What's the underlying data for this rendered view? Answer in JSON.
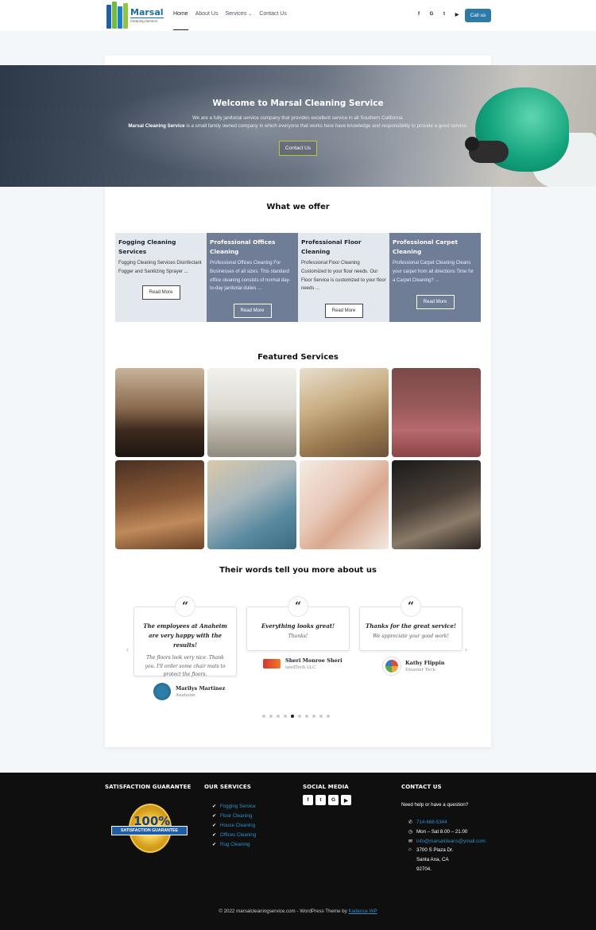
{
  "header": {
    "logo": {
      "name": "Marsal",
      "tagline": "Cleaning Service"
    },
    "nav": [
      {
        "label": "Home",
        "active": true
      },
      {
        "label": "About Us"
      },
      {
        "label": "Services",
        "has_dropdown": true
      },
      {
        "label": "Contact Us"
      }
    ],
    "social_icons": [
      "facebook-icon",
      "google-icon",
      "twitter-icon",
      "youtube-icon"
    ],
    "call_button": "Call us"
  },
  "hero": {
    "title": "Welcome to Marsal Cleaning Service",
    "line1": "We are a fully janitorial service company that provides excellent service in all Southern California.",
    "line2_bold": "Marsal Cleaning Service",
    "line2_rest": " is a small family owned company in which everyone that works here have knowledge and responsibility to provide a good service.",
    "button": "Contact Us"
  },
  "offer": {
    "title": "What we offer",
    "items": [
      {
        "title": "Fogging Cleaning Services",
        "text": "Fogging Cleaning Services Disinfectant Fogger and Sanitizing Sprayer ...",
        "button": "Read More",
        "style": "light"
      },
      {
        "title": "Professional Offices Cleaning",
        "text": "Professional Offices Cleaning For Businesses of all sizes. This standard office cleaning consists of normal day-to-day janitorial duties ...",
        "button": "Read More",
        "style": "dark"
      },
      {
        "title": "Professional Floor Cleaning",
        "text": "Professional Floor Cleaning Customized to your floor needs. Our Floor Service is customized to your floor needs ...",
        "button": "Read More",
        "style": "light"
      },
      {
        "title": "Professional Carpet Cleaning",
        "text": "Professional Carpet Cleaning Cleans your carpet from all directions Time for a Carpet Cleaning? ...",
        "button": "Read More",
        "style": "dark"
      }
    ]
  },
  "featured": {
    "title": "Featured Services"
  },
  "testimonials": {
    "title": "Their words tell you more about us",
    "items": [
      {
        "headline": "The employees at Anaheim are very happy with the results!",
        "body": "The floors look very nice. Thank you. I'll order some chair mats to protect the floors.",
        "name": "Marilys Martinez",
        "place": "Anaheim"
      },
      {
        "headline": "Everything looks great!",
        "body": "Thanks!",
        "name": "Sheri Monroe Sheri",
        "place": "landTech LLC"
      },
      {
        "headline": "Thanks for the great service!",
        "body": "We appreciate your good work!",
        "name": "Kathy Flippin",
        "place": "Disaster Tech"
      }
    ],
    "page_count": 10,
    "active_page": 5
  },
  "footer": {
    "guarantee": {
      "heading": "SATISFACTION GUARANTEE",
      "seal_number": "100%",
      "seal_text": "SATISFACTION GUARANTEE"
    },
    "services": {
      "heading": "OUR SERVICES",
      "items": [
        "Fogging Service",
        "Floor Cleaning",
        "House Cleaning",
        "Offices Cleaning",
        "Rug Cleaning"
      ]
    },
    "social": {
      "heading": "SOCIAL MEDIA",
      "icons": [
        "facebook-icon",
        "twitter-icon",
        "google-icon",
        "youtube-icon"
      ]
    },
    "contact": {
      "heading": "CONTACT US",
      "intro": "Need help or have a question?",
      "phone": "714-668-5344",
      "hours": "Mon – Sat 8.00 – 21.00",
      "email": "info@marsalcleans@ymail.com",
      "address_line1": "3700 S Plaza Dr.",
      "address_line2": "Santa Ana, CA",
      "address_line3": "92704."
    },
    "copyright_prefix": "© 2022 marsalcleaningservice.com - WordPress Theme by ",
    "copyright_link": "Kadence WP"
  }
}
